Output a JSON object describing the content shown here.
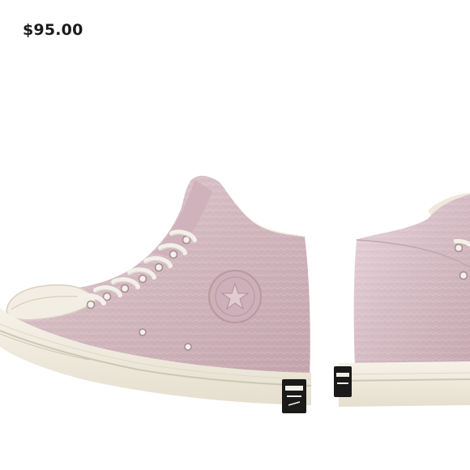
{
  "listing": {
    "price": "$95.00"
  },
  "product": {
    "image_icon": "sneaker-photo",
    "colors": {
      "upper": "#d9c2c9",
      "upper_shadow": "#b89aa4",
      "sole": "#f1ece0",
      "sole_stripe": "#5a3e3e",
      "lining": "#efe9dc",
      "laces": "#f3f0ea",
      "heel_label": "#1a1a1a"
    }
  }
}
